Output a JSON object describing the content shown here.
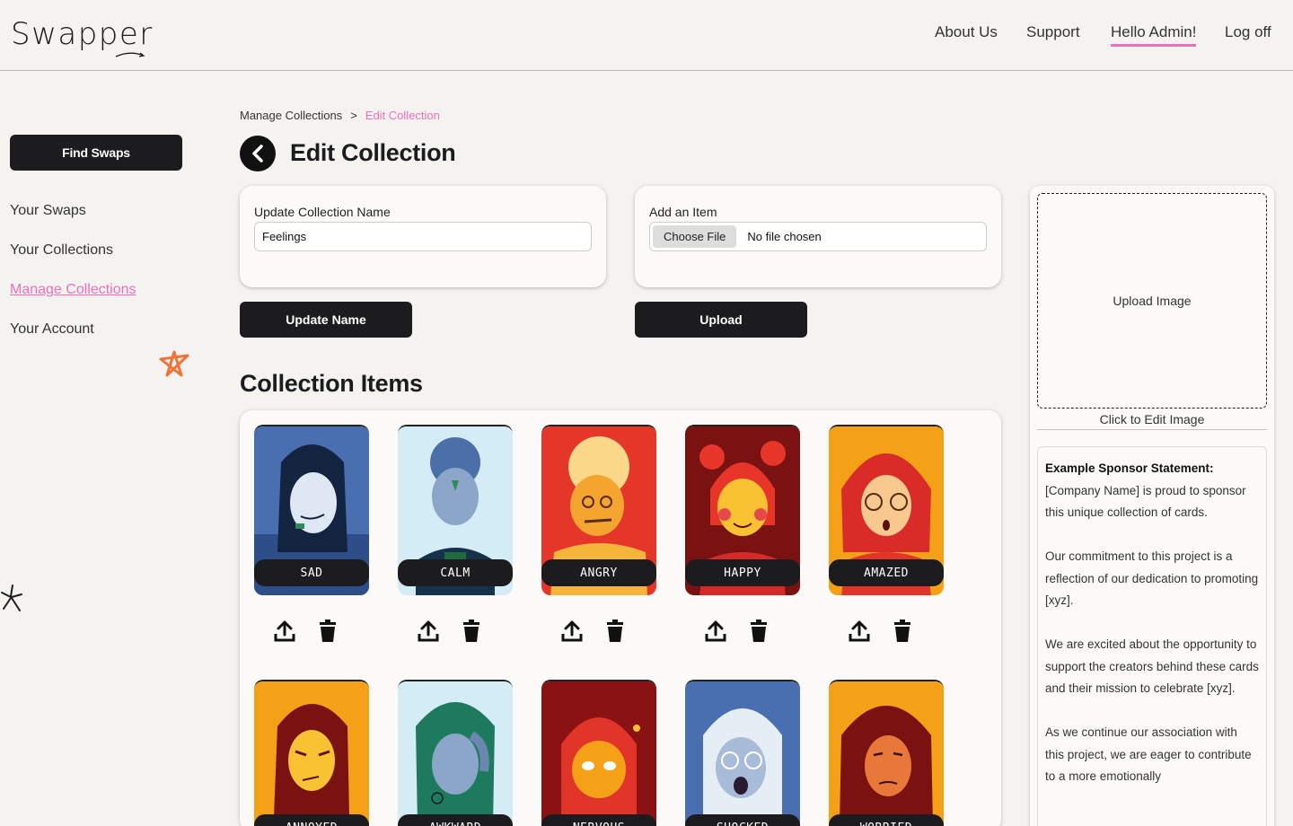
{
  "header": {
    "logo": "Swapper",
    "nav": [
      {
        "label": "About Us"
      },
      {
        "label": "Support"
      },
      {
        "label": "Hello Admin!"
      },
      {
        "label": "Log off"
      }
    ],
    "accent": "#f06dbb"
  },
  "sidebar": {
    "primary_button": "Find Swaps",
    "items": [
      {
        "label": "Your Swaps"
      },
      {
        "label": "Your Collections"
      },
      {
        "label": "Manage Collections",
        "active": true
      },
      {
        "label": "Your Account"
      }
    ]
  },
  "breadcrumb": {
    "parent": "Manage Collections",
    "separator": ">",
    "current": "Edit Collection"
  },
  "page": {
    "title": "Edit Collection",
    "back_icon": "chevron-left-icon"
  },
  "name_form": {
    "label": "Update Collection Name",
    "value": "Feelings",
    "button": "Update Name"
  },
  "item_form": {
    "label": "Add an Item",
    "file_button": "Choose File",
    "file_status": "No file chosen",
    "button": "Upload"
  },
  "collection": {
    "title": "Collection Items",
    "items": [
      {
        "label": "SAD"
      },
      {
        "label": "CALM"
      },
      {
        "label": "ANGRY"
      },
      {
        "label": "HAPPY"
      },
      {
        "label": "AMAZED"
      },
      {
        "label": "ANNOYED"
      },
      {
        "label": "AWKWARD"
      },
      {
        "label": "NERVOUS"
      },
      {
        "label": "SHOCKED"
      },
      {
        "label": "WORRIED"
      }
    ]
  },
  "sponsor": {
    "upload_label": "Upload Image",
    "edit_caption": "Click to Edit Image",
    "statement_title": "Example Sponsor Statement:",
    "paragraphs": [
      "[Company Name] is proud to sponsor this unique collection of cards.",
      "Our commitment to this project is a reflection of our dedication to promoting [xyz].",
      "We are excited about the opportunity to support the creators behind these cards and their mission to celebrate [xyz].",
      "As we continue our association with this project, we are eager to contribute to a more emotionally"
    ]
  }
}
